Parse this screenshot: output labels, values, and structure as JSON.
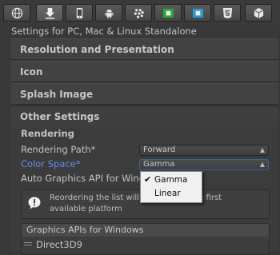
{
  "platform_tabs": [
    {
      "icon": "globe-icon"
    },
    {
      "icon": "download-icon"
    },
    {
      "icon": "phone-icon"
    },
    {
      "icon": "android-icon"
    },
    {
      "icon": "blackberry-icon"
    },
    {
      "icon": "xbox-icon"
    },
    {
      "icon": "windows-store-icon"
    },
    {
      "icon": "html5-icon"
    },
    {
      "icon": "cube-icon"
    }
  ],
  "settings_title": "Settings for PC, Mac & Linux Standalone",
  "sections": {
    "resolution": "Resolution and Presentation",
    "icon": "Icon",
    "splash": "Splash Image",
    "other": "Other Settings"
  },
  "rendering": {
    "heading": "Rendering",
    "rendering_path_label": "Rendering Path*",
    "rendering_path_value": "Forward",
    "color_space_label": "Color Space*",
    "color_space_value": "Gamma",
    "auto_graphics_label": "Auto Graphics API for Wind"
  },
  "help": {
    "line1_left": "Reordering the list will",
    "line1_right": "the first",
    "line2": "available platform"
  },
  "graphics_list": {
    "header": "Graphics APIs for Windows",
    "items": [
      "Direct3D9"
    ]
  },
  "color_space_menu": {
    "options": [
      "Gamma",
      "Linear"
    ],
    "selected": "Gamma"
  },
  "colors": {
    "background": "#383838",
    "accent_blue": "#5c8fe6",
    "menu_background": "#f0f0f0"
  }
}
